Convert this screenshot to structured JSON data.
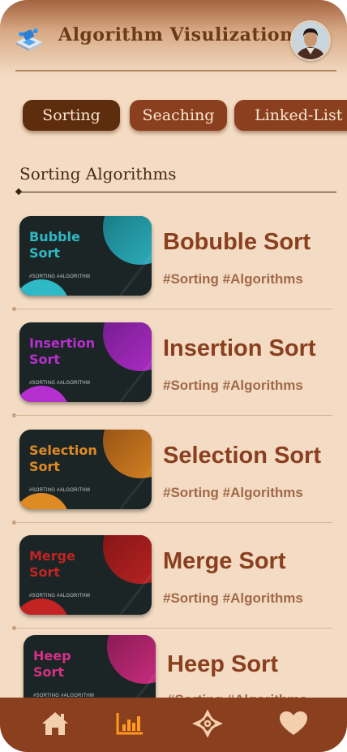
{
  "header": {
    "title": "Algorithm Visulization",
    "logo_icon": "data-structure-logo-icon",
    "avatar_icon": "user-avatar"
  },
  "tabs": [
    {
      "label": "Sorting",
      "active": true
    },
    {
      "label": "Seaching",
      "active": false
    },
    {
      "label": "Linked-List",
      "active": false
    }
  ],
  "section": {
    "title": "Sorting Algorithms"
  },
  "items": [
    {
      "thumb_title": "Bubble\nSort",
      "thumb_tag": "#SORTING #ALGORITHM",
      "title": "Bobuble Sort",
      "tags": "#Sorting #Algorithms",
      "accent": "#2fb8c5",
      "accent_dark": "#16707a"
    },
    {
      "thumb_title": "Insertion\nSort",
      "thumb_tag": "#SORTING #ALGORITHM",
      "title": "Insertion Sort",
      "tags": "#Sorting #Algorithms",
      "accent": "#b62fcf",
      "accent_dark": "#6a1a83"
    },
    {
      "thumb_title": "Selection\nSort",
      "thumb_tag": "#SORTING #ALGORITHM",
      "title": "Selection Sort",
      "tags": "#Sorting #Algorithms",
      "accent": "#e08a24",
      "accent_dark": "#8a4a14"
    },
    {
      "thumb_title": "Merge\nSort",
      "thumb_tag": "#SORTING #ALGORITHM",
      "title": "Merge Sort",
      "tags": "#Sorting #Algorithms",
      "accent": "#c22424",
      "accent_dark": "#7a1414"
    },
    {
      "thumb_title": "Heep\nSort",
      "thumb_tag": "#SORTING #ALGORITHM",
      "title": "Heep Sort",
      "tags": "#Sorting #Algorithms",
      "accent": "#d62f86",
      "accent_dark": "#7a184c"
    }
  ],
  "bottom_nav": [
    {
      "icon": "home-icon",
      "active": false
    },
    {
      "icon": "bar-chart-icon",
      "active": true
    },
    {
      "icon": "ornament-icon",
      "active": false
    },
    {
      "icon": "heart-icon",
      "active": false
    }
  ],
  "colors": {
    "background": "#f3dcc3",
    "primary": "#8a3f1f",
    "tab_active": "#5d2d0e",
    "nav_icon": "#f3cfae",
    "nav_icon_active": "#ff9a1f"
  }
}
